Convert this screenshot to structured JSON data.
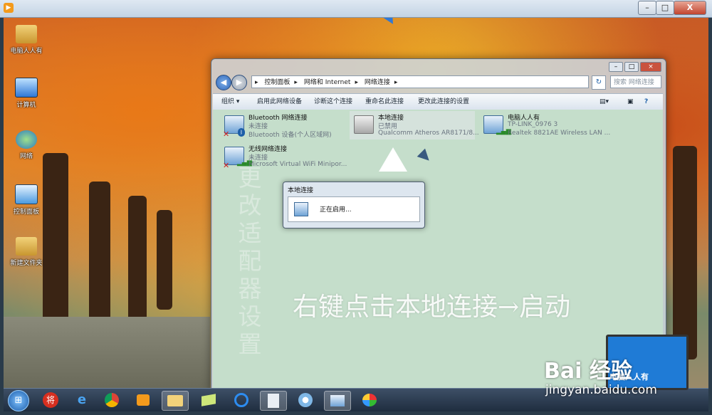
{
  "window": {
    "close_glyph": "X",
    "max_glyph": "□",
    "min_glyph": "–"
  },
  "desktop_icons": [
    {
      "label": "电脑人人有"
    },
    {
      "label": "计算机"
    },
    {
      "label": "网络"
    },
    {
      "label": "控制面板"
    },
    {
      "label": "新建文件夹"
    }
  ],
  "explorer": {
    "breadcrumb": [
      "控制面板",
      "网络和 Internet",
      "网络连接"
    ],
    "search_placeholder": "搜索 网络连接",
    "toolbar": [
      "组织 ▾",
      "启用此网络设备",
      "诊断这个连接",
      "重命名此连接",
      "更改此连接的设置"
    ],
    "connections": [
      {
        "name": "Bluetooth 网络连接",
        "status": "未连接",
        "device": "Bluetooth 设备(个人区域网)"
      },
      {
        "name": "本地连接",
        "status": "已禁用",
        "device": "Qualcomm Atheros AR8171/8..."
      },
      {
        "name": "电脑人人有",
        "status": "TP-LINK_0976  3",
        "device": "Realtek 8821AE Wireless LAN ..."
      },
      {
        "name": "无线网络连接",
        "status": "未连接",
        "device": "Microsoft Virtual WiFi Minipor..."
      }
    ],
    "dialog": {
      "title": "本地连接",
      "message": "正在启用..."
    }
  },
  "overlay": {
    "vertical_text": "更改适配器设置",
    "instruction": "右键点击本地连接→启动"
  },
  "watermark": {
    "brand": "Bai 经验",
    "url": "jingyan.baidu.com",
    "laptop_text": "电脑人人有"
  },
  "colors": {
    "content_bg": "#c5decb",
    "accent": "#1d5fa8",
    "close_red": "#c2452f"
  }
}
